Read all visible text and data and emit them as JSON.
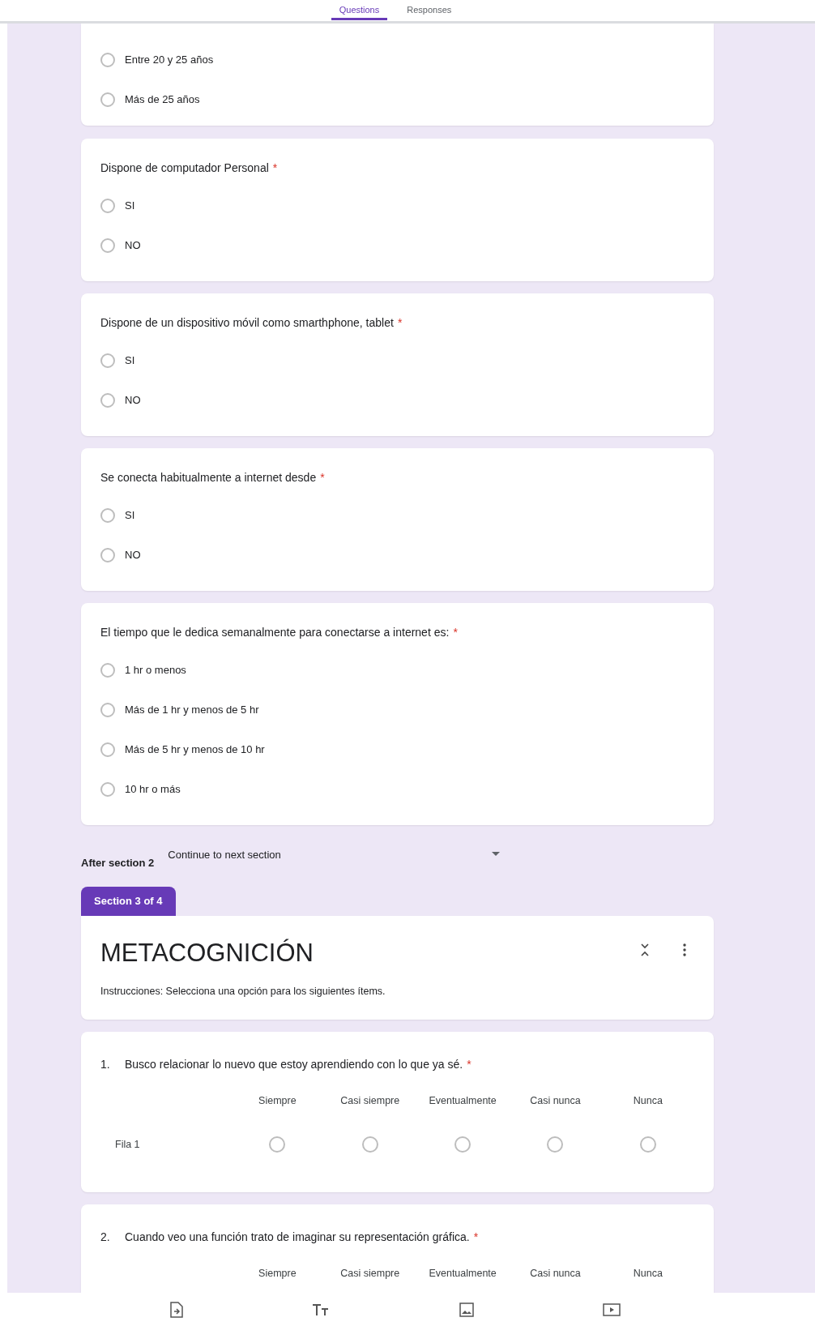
{
  "tabs": [
    {
      "label": "Questions",
      "selected": true
    },
    {
      "label": "Responses",
      "selected": false
    }
  ],
  "partial_question": {
    "options": [
      {
        "label": "Entre 20 y 25 años",
        "selected": false
      },
      {
        "label": "Más de 25  años",
        "selected": false
      }
    ]
  },
  "questions": [
    {
      "title": "Dispone de computador Personal",
      "required_mark": "*",
      "options": [
        {
          "label": "SI",
          "selected": false
        },
        {
          "label": "NO",
          "selected": false
        }
      ]
    },
    {
      "title": "Dispone de un dispositivo móvil como smarthphone, tablet",
      "required_mark": "*",
      "options": [
        {
          "label": "SI",
          "selected": false
        },
        {
          "label": "NO",
          "selected": false
        }
      ]
    },
    {
      "title": "Se conecta habitualmente a internet desde",
      "required_mark": "*",
      "options": [
        {
          "label": "SI",
          "selected": false
        },
        {
          "label": "NO",
          "selected": false
        }
      ]
    },
    {
      "title": "El tiempo que le dedica semanalmente para conectarse a internet es:",
      "required_mark": "*",
      "options": [
        {
          "label": "1 hr o menos",
          "selected": false
        },
        {
          "label": "Más de 1 hr y menos de 5 hr",
          "selected": false
        },
        {
          "label": "Más de 5 hr y menos de 10 hr",
          "selected": false
        },
        {
          "label": "10 hr o más",
          "selected": false
        }
      ]
    }
  ],
  "after_section": {
    "label": "After section 2",
    "value": "Continue to next section"
  },
  "section": {
    "tag": "Section 3 of 4",
    "title": "METACOGNICIÓN",
    "description": "Instrucciones: Selecciona una opción para los siguientes ítems."
  },
  "grid_questions": [
    {
      "number": "1.",
      "title": "Busco relacionar lo nuevo que estoy aprendiendo con lo que ya sé.",
      "required_mark": "*",
      "columns": [
        "Siempre",
        "Casi siempre",
        "Eventualmente",
        "Casi nunca",
        "Nunca"
      ],
      "rows": [
        {
          "label": "Fila 1",
          "selected": [
            false,
            false,
            false,
            false,
            false
          ]
        }
      ]
    },
    {
      "number": "2.",
      "title": "Cuando veo una función trato de imaginar su representación gráfica.",
      "required_mark": "*",
      "columns": [
        "Siempre",
        "Casi siempre",
        "Eventualmente",
        "Casi nunca",
        "Nunca"
      ]
    }
  ],
  "toolbar": [
    {
      "kind": "import"
    },
    {
      "kind": "title"
    },
    {
      "kind": "image"
    },
    {
      "kind": "video"
    }
  ]
}
